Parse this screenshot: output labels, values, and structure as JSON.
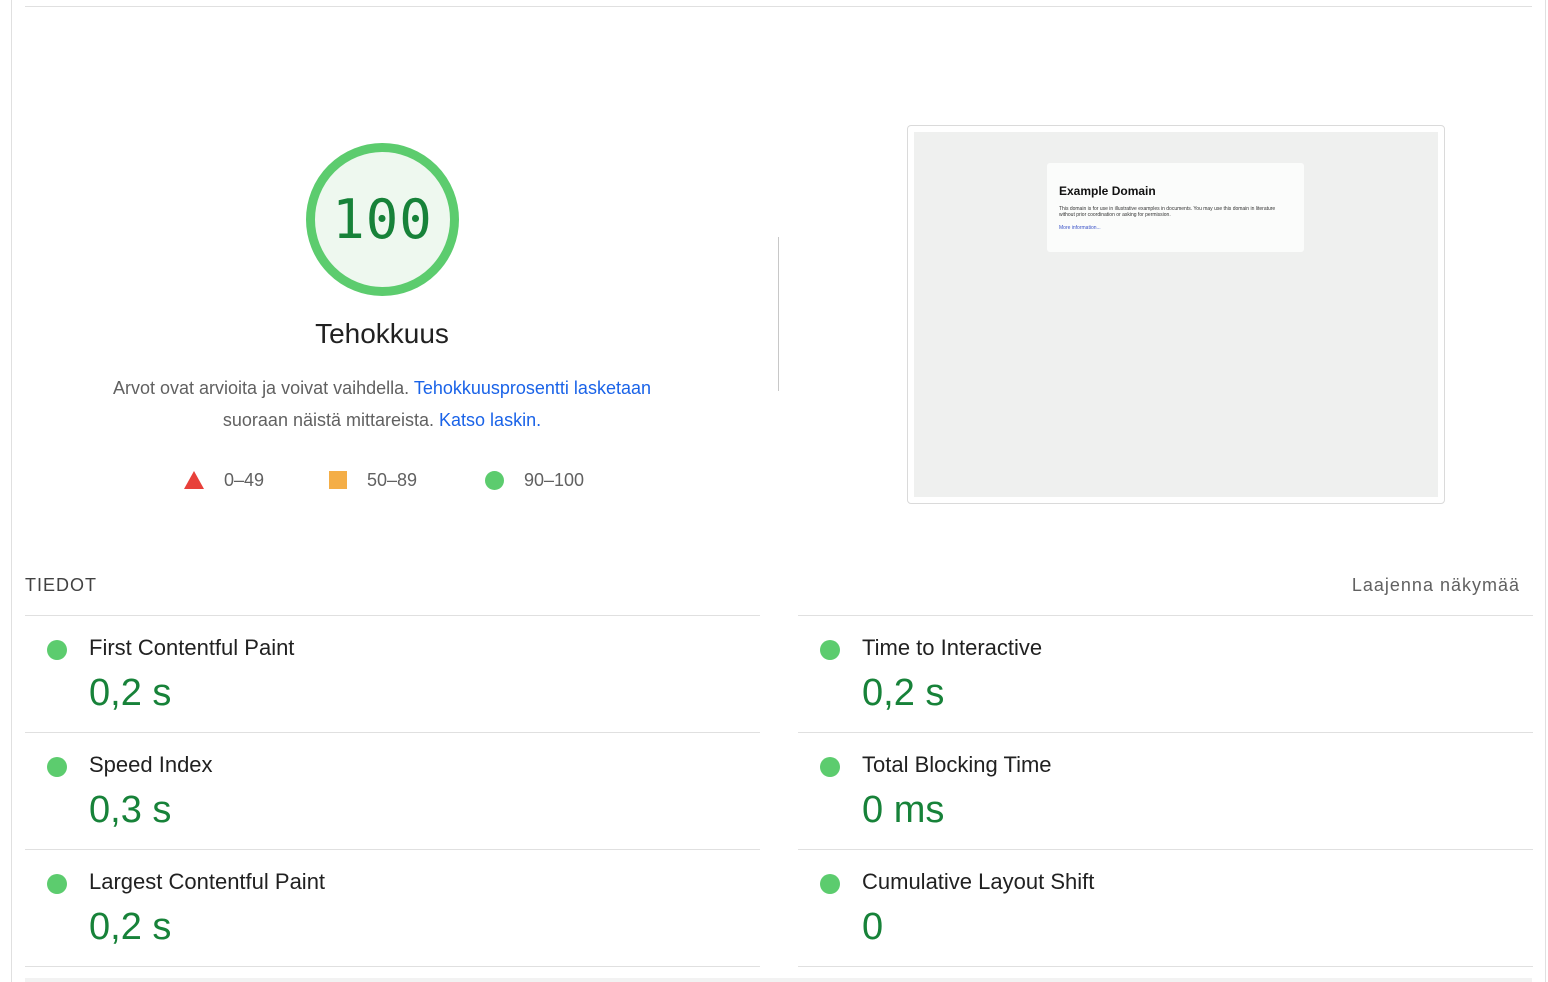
{
  "score": {
    "value": "100",
    "title": "Tehokkuus",
    "color": "#5ccc6e"
  },
  "description": {
    "text1": "Arvot ovat arvioita ja voivat vaihdella.",
    "link1": "Tehokkuusprosentti lasketaan",
    "text2": "suoraan näistä mittareista.",
    "link2": "Katso laskin."
  },
  "legend": [
    {
      "range": "0–49",
      "icon": "triangle-icon",
      "color": "#e8403a"
    },
    {
      "range": "50–89",
      "icon": "square-icon",
      "color": "#f4ae47"
    },
    {
      "range": "90–100",
      "icon": "circle-icon",
      "color": "#5ccc6e"
    }
  ],
  "screenshot": {
    "page_title": "Example Domain",
    "page_text": "This domain is for use in illustrative examples in documents. You may use this domain in literature without prior coordination or asking for permission.",
    "page_link": "More information..."
  },
  "metrics": {
    "heading": "TIEDOT",
    "expand_label": "Laajenna näkymää",
    "left": [
      {
        "name": "First Contentful Paint",
        "value": "0,2 s"
      },
      {
        "name": "Speed Index",
        "value": "0,3 s"
      },
      {
        "name": "Largest Contentful Paint",
        "value": "0,2 s"
      }
    ],
    "right": [
      {
        "name": "Time to Interactive",
        "value": "0,2 s"
      },
      {
        "name": "Total Blocking Time",
        "value": "0 ms"
      },
      {
        "name": "Cumulative Layout Shift",
        "value": "0"
      }
    ]
  }
}
